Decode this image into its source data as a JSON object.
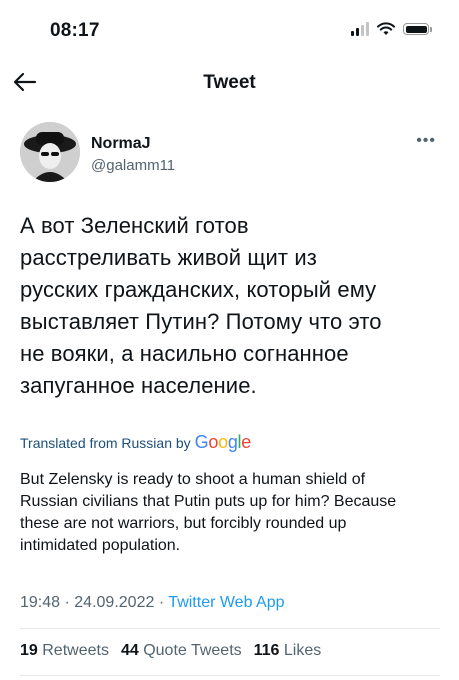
{
  "status_bar": {
    "time": "08:17"
  },
  "nav": {
    "title": "Tweet"
  },
  "tweet": {
    "author_name": "NormaJ",
    "author_handle": "@galamm11",
    "text": "А вот Зеленский готов\nрасстреливать живой щит из\nрусских гражданских, который ему\nвыставляет Путин?  Потому что это\nне вояки, а насильно согнанное\nзапуганное население.",
    "translated_label": "Translated from Russian by",
    "translator": "Google",
    "translation": "But Zelensky is ready to shoot a human shield of\nRussian civilians that Putin puts up for him? Because\nthese are not warriors, but forcibly rounded up\nintimidated population.",
    "time": "19:48",
    "date": "24.09.2022",
    "source": "Twitter Web App",
    "stats": {
      "retweets_count": "19",
      "retweets_label": "Retweets",
      "quotes_count": "44",
      "quotes_label": "Quote Tweets",
      "likes_count": "116",
      "likes_label": "Likes"
    }
  },
  "icons": [
    "back-arrow-icon",
    "more-icon",
    "signal-icon",
    "wifi-icon",
    "battery-icon"
  ],
  "colors": {
    "link": "#1d9bf0",
    "secondary_text": "#536471",
    "text": "#0f1419"
  }
}
